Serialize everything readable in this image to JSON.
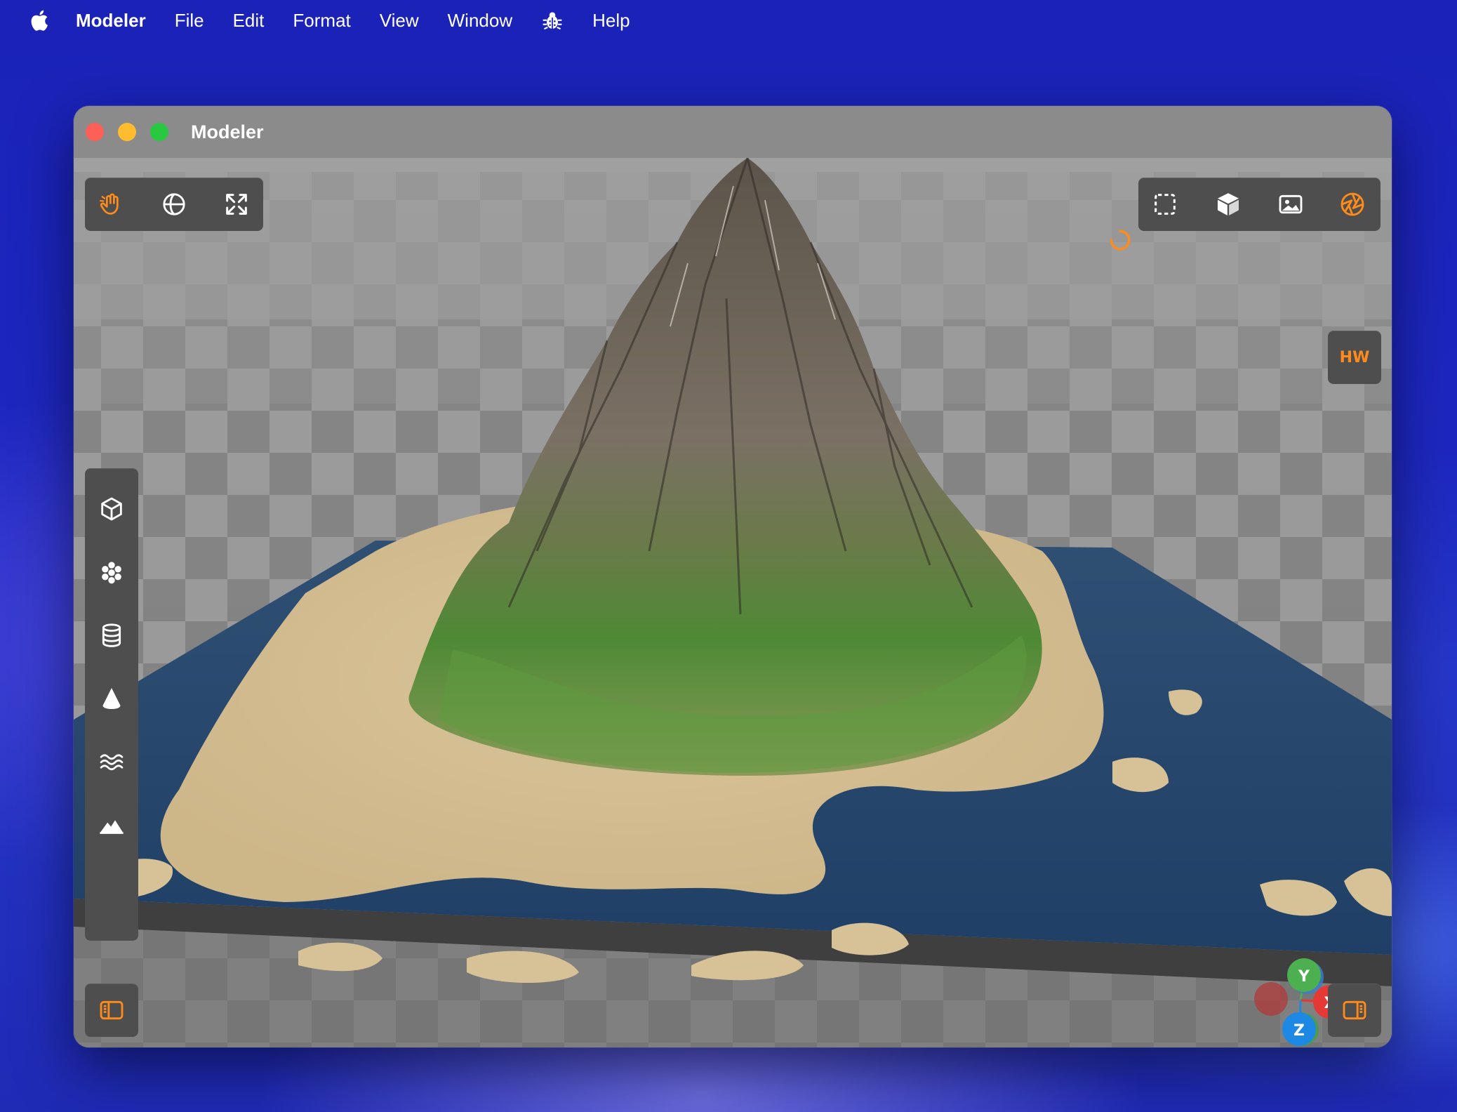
{
  "menubar": {
    "app_name": "Modeler",
    "items": [
      "File",
      "Edit",
      "Format",
      "View",
      "Window",
      "Help"
    ]
  },
  "window": {
    "title": "Modeler"
  },
  "viewport": {
    "top_left_tools": [
      "hand-tool-icon",
      "globe-icon",
      "expand-arrows-icon"
    ],
    "top_right_tools": [
      "selection-rect-icon",
      "cube-icon",
      "image-icon",
      "aperture-icon"
    ],
    "hw_label": "HW",
    "side_tools": [
      "cube-outline-icon",
      "particles-icon",
      "database-icon",
      "cone-icon",
      "water-waves-icon",
      "terrain-icon"
    ],
    "axis_gizmo": {
      "y_label": "Y",
      "x_label": "X",
      "z_label": "Z"
    },
    "colors": {
      "accent": "#ff8c1a",
      "toolbar_bg": "#4e4e4e",
      "axis_y": "#4caf50",
      "axis_x": "#e53935",
      "axis_z": "#1e88e5"
    }
  }
}
